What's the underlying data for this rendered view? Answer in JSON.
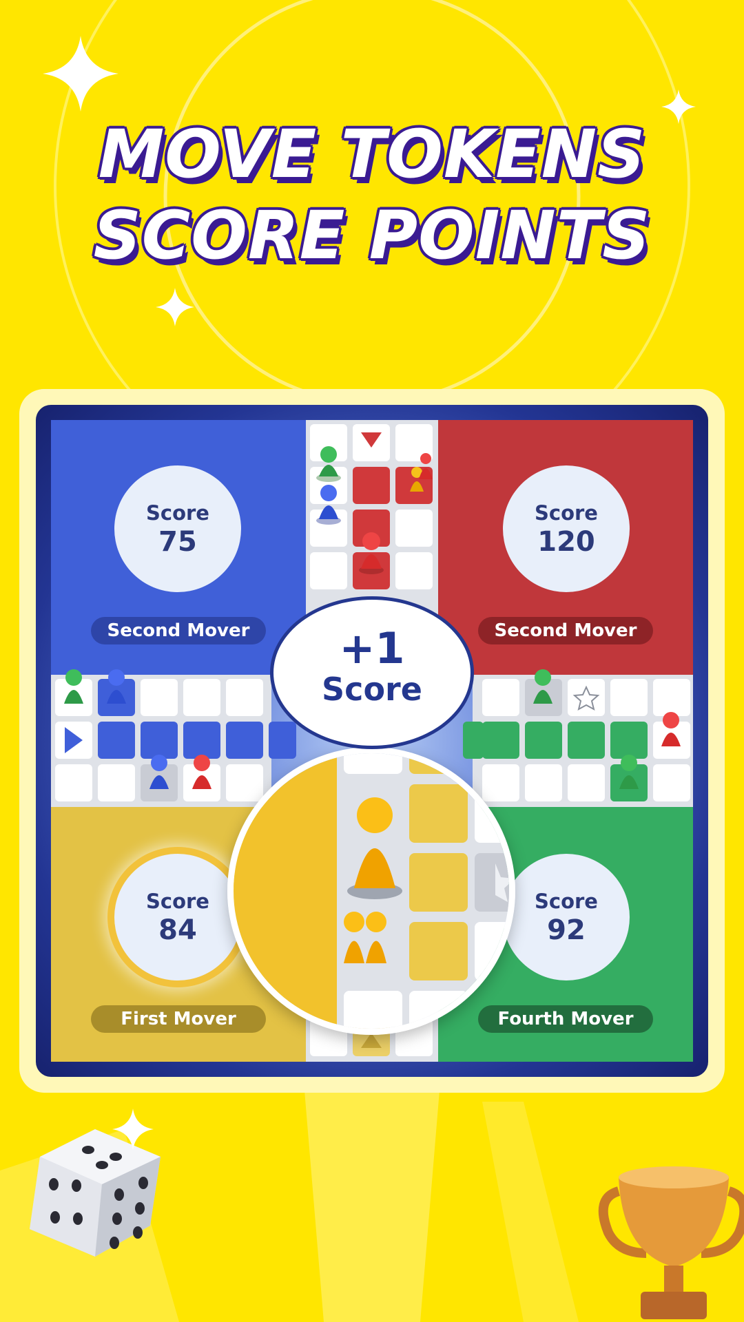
{
  "headline": {
    "line1": "MOVE TOKENS",
    "line2": "SCORE POINTS"
  },
  "colors": {
    "background": "#ffe600",
    "blue": "#4060d8",
    "red": "#c0373b",
    "yellow": "#e3c245",
    "green": "#35ad62",
    "outline": "#3a1b92"
  },
  "players": {
    "blue": {
      "score_label": "Score",
      "score": "75",
      "role": "Second Mover"
    },
    "red": {
      "score_label": "Score",
      "score": "120",
      "role": "Second Mover"
    },
    "yellow": {
      "score_label": "Score",
      "score": "84",
      "role": "First Mover"
    },
    "green": {
      "score_label": "Score",
      "score": "92",
      "role": "Fourth Mover"
    }
  },
  "popup": {
    "value": "+1",
    "label": "Score"
  },
  "decorations": {
    "dice_icon": "dice-icon",
    "trophy_icon": "trophy-icon"
  }
}
